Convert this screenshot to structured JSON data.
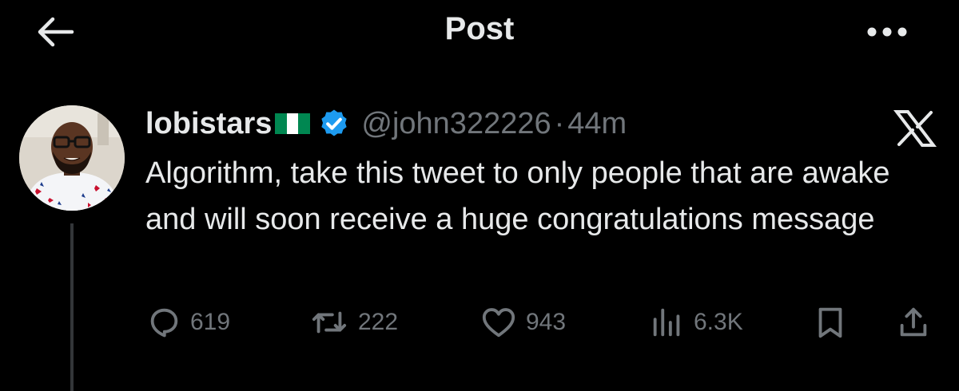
{
  "header": {
    "title": "Post",
    "back_icon": "arrow-left-icon",
    "more_icon": "more-horizontal-icon"
  },
  "tweet": {
    "display_name": "lobistars",
    "flag_icon": "nigeria-flag-icon",
    "verified_icon": "verified-badge-icon",
    "handle": "@john322226",
    "separator": "·",
    "time_ago": "44m",
    "text": "Algorithm, take this tweet to only people that are awake and will soon receive a huge congratulations message",
    "source_icon": "x-logo-icon"
  },
  "actions": {
    "replies": "619",
    "reposts": "222",
    "likes": "943",
    "views": "6.3K",
    "bookmark_icon": "bookmark-icon",
    "share_icon": "share-icon"
  },
  "colors": {
    "background": "#000000",
    "primary_text": "#e7e9ea",
    "secondary_text": "#71767b",
    "verified": "#1d9bf0",
    "flag_green": "#008751"
  }
}
